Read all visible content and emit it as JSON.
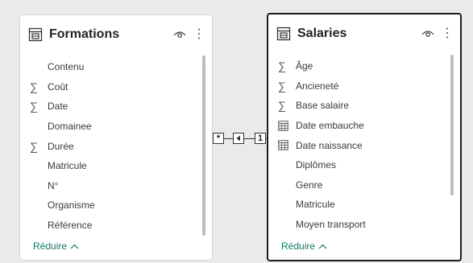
{
  "tables": [
    {
      "title": "Formations",
      "fields": [
        {
          "icon": "none",
          "label": "Contenu"
        },
        {
          "icon": "sigma-icon",
          "label": "Coût"
        },
        {
          "icon": "sigma-icon",
          "label": "Date"
        },
        {
          "icon": "none",
          "label": "Domainee"
        },
        {
          "icon": "sigma-icon",
          "label": "Durée"
        },
        {
          "icon": "none",
          "label": "Matricule"
        },
        {
          "icon": "none",
          "label": "N°"
        },
        {
          "icon": "none",
          "label": "Organisme"
        },
        {
          "icon": "none",
          "label": "Référence"
        }
      ],
      "collapse_label": "Réduire"
    },
    {
      "title": "Salaries",
      "fields": [
        {
          "icon": "sigma-icon",
          "label": "Âge"
        },
        {
          "icon": "sigma-icon",
          "label": "Ancieneté"
        },
        {
          "icon": "sigma-icon",
          "label": "Base salaire"
        },
        {
          "icon": "calendar-icon",
          "label": "Date embauche"
        },
        {
          "icon": "calendar-icon",
          "label": "Date naissance"
        },
        {
          "icon": "none",
          "label": "Diplômes"
        },
        {
          "icon": "none",
          "label": "Genre"
        },
        {
          "icon": "none",
          "label": "Matricule"
        },
        {
          "icon": "none",
          "label": "Moyen transport"
        }
      ],
      "collapse_label": "Réduire"
    }
  ],
  "relationship": {
    "many_side": "*",
    "one_side": "1",
    "direction_icon": "arrow-left-icon"
  },
  "colors": {
    "accent": "#117865",
    "selected_border": "#1b1b1b"
  }
}
